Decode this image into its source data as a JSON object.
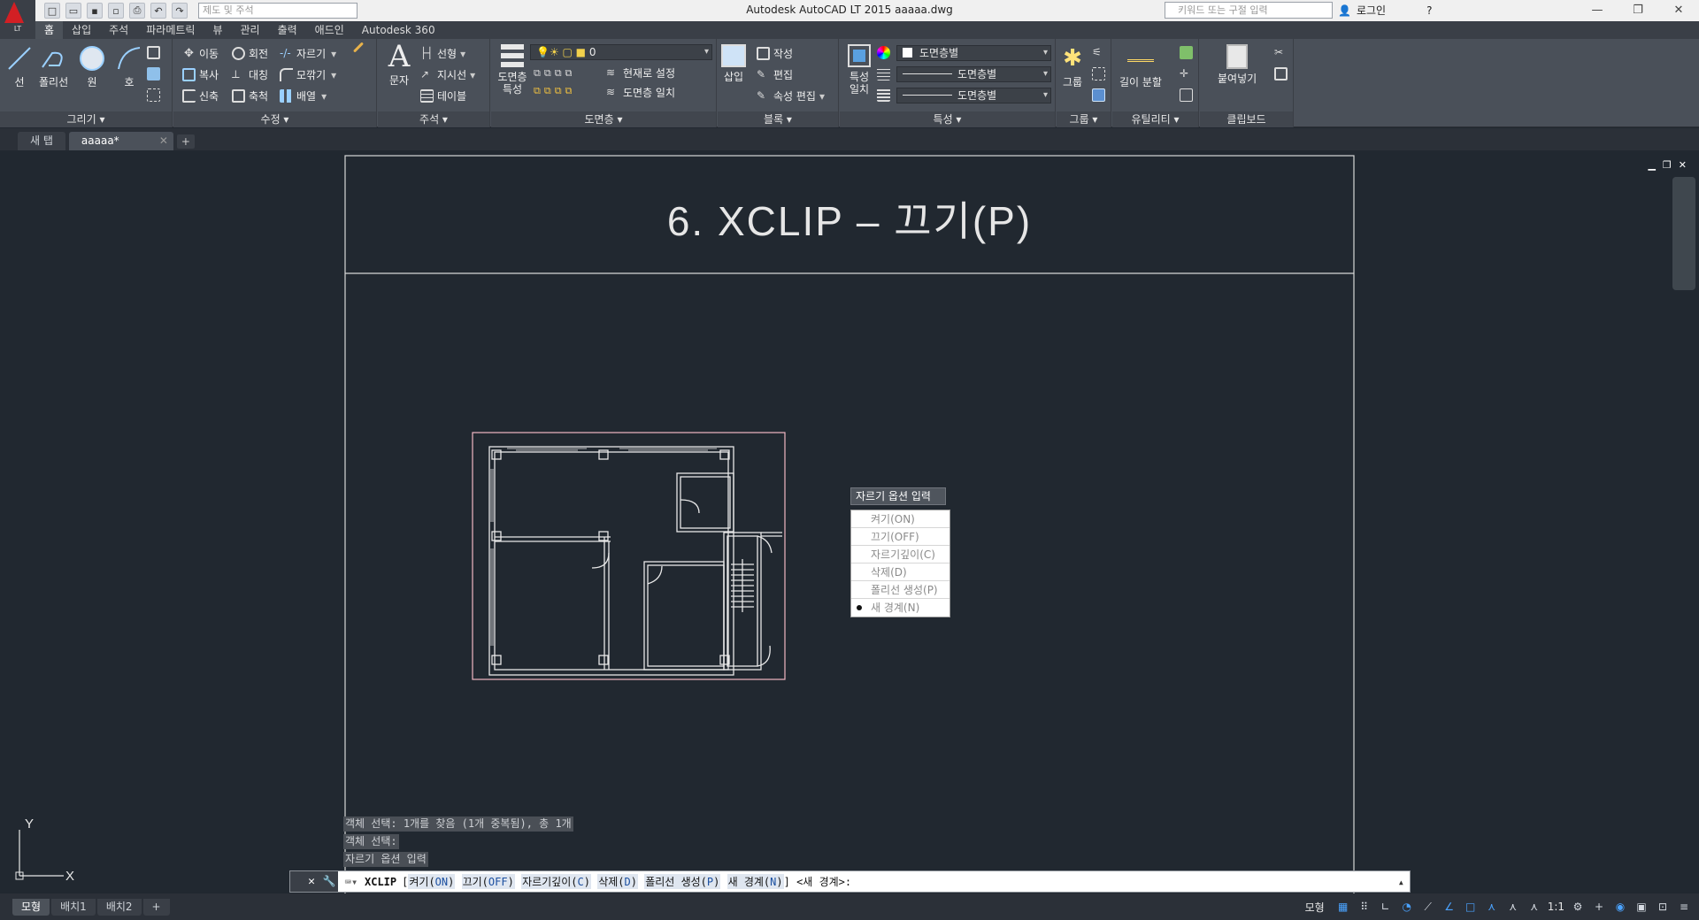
{
  "app": {
    "logo_text": "LT",
    "window_title": "Autodesk AutoCAD LT 2015     aaaaa.dwg",
    "workspace_placeholder": "제도 및 주석",
    "search_placeholder": "키워드 또는 구절 입력",
    "login_label": "로그인"
  },
  "ribbon_tabs": [
    "홈",
    "삽입",
    "주석",
    "파라메트릭",
    "뷰",
    "관리",
    "출력",
    "애드인",
    "Autodesk 360"
  ],
  "ribbon": {
    "draw": {
      "title": "그리기 ▾",
      "line": "선",
      "polyline": "폴리선",
      "circle": "원",
      "arc": "호"
    },
    "modify": {
      "title": "수정 ▾",
      "move": "이동",
      "rotate": "회전",
      "trim": "자르기",
      "copy": "복사",
      "mirror": "대칭",
      "fillet": "모깎기",
      "stretch": "신축",
      "scale": "축척",
      "array": "배열"
    },
    "annotation": {
      "title": "주석 ▾",
      "text": "문자",
      "linear": "선형",
      "leader": "지시선",
      "table": "테이블"
    },
    "layers": {
      "title": "도면층 ▾",
      "props": "도면층\n특성",
      "current_layer": "0",
      "make_current": "현재로 설정",
      "match": "도면층 일치"
    },
    "block": {
      "title": "블록 ▾",
      "insert": "삽입",
      "create": "작성",
      "edit": "편집",
      "edit_attr": "속성 편집"
    },
    "properties": {
      "title": "특성 ▾",
      "match": "특성\n일치",
      "color": "도면층별",
      "linetype": "도면층별",
      "lineweight": "도면층별"
    },
    "groups": {
      "title": "그룹 ▾",
      "group": "그룹"
    },
    "utilities": {
      "title": "유틸리티 ▾",
      "measure": "길이 분할"
    },
    "clipboard": {
      "title": "클립보드",
      "paste": "붙여넣기"
    }
  },
  "file_tabs": [
    {
      "label": "새 탭",
      "active": false
    },
    {
      "label": "aaaaa*",
      "active": true
    }
  ],
  "drawing": {
    "sheet_title": "6. XCLIP – 끄기(P)"
  },
  "clip_menu": {
    "title": "자르기 옵션 입력",
    "items": [
      {
        "label": "켜기(ON)",
        "selected": false
      },
      {
        "label": "끄기(OFF)",
        "selected": false
      },
      {
        "label": "자르기깊이(C)",
        "selected": false
      },
      {
        "label": "삭제(D)",
        "selected": false
      },
      {
        "label": "폴리선 생성(P)",
        "selected": false
      },
      {
        "label": "새 경계(N)",
        "selected": true
      }
    ]
  },
  "command_history": [
    "객체 선택: 1개를 찾음 (1개 중복됨), 총 1개",
    "객체 선택:",
    "자르기 옵션 입력"
  ],
  "command_line": {
    "command": "XCLIP",
    "bracket_open": "[",
    "opt1_text": "켜기(",
    "opt1_key": "ON",
    "opt2_text": "끄기(",
    "opt2_key": "OFF",
    "opt3_text": "자르기깊이(",
    "opt3_key": "C",
    "opt4_text": "삭제(",
    "opt4_key": "D",
    "opt5_text": "폴리선 생성(",
    "opt5_key": "P",
    "opt6_text": "새 경계(",
    "opt6_key": "N",
    "tail": "] <새 경계>:"
  },
  "ucs": {
    "x": "X",
    "y": "Y"
  },
  "layout_tabs": [
    {
      "label": "모형",
      "active": true
    },
    {
      "label": "배치1",
      "active": false
    },
    {
      "label": "배치2",
      "active": false
    }
  ],
  "status_bar": {
    "model": "모형",
    "scale": "1:1"
  },
  "colors": {
    "accent": "#d21f24",
    "canvas": "#212830",
    "ribbon": "#4a5059"
  }
}
